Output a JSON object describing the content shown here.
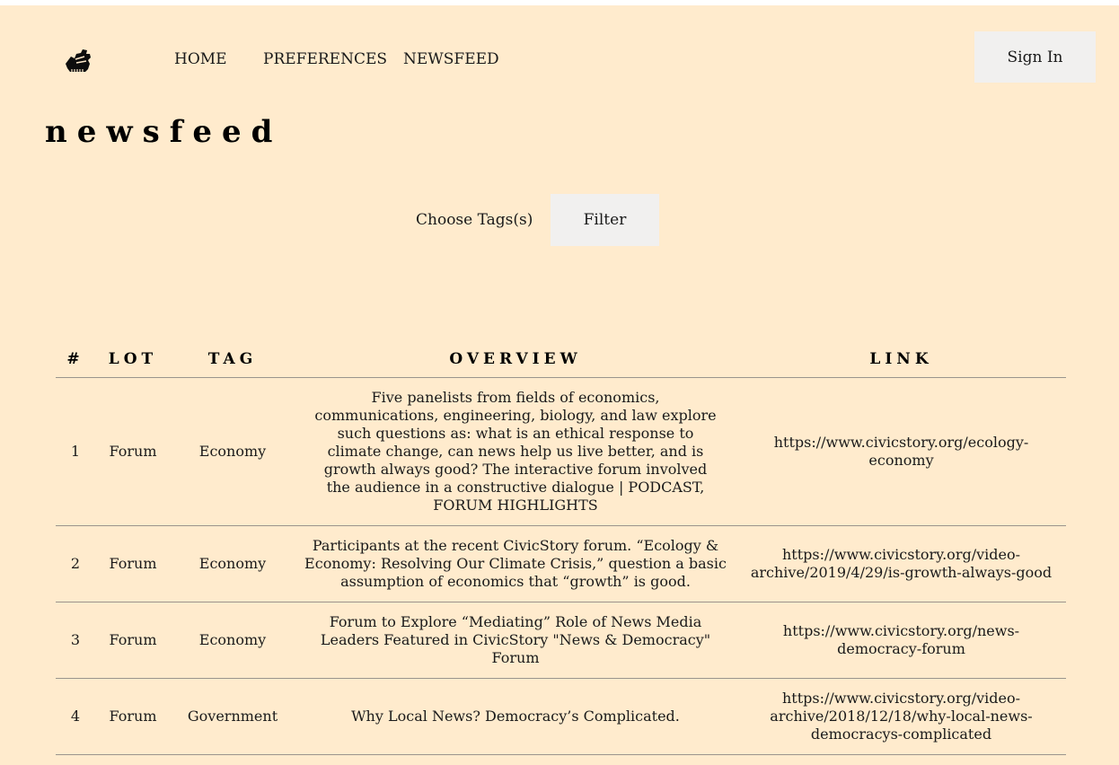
{
  "nav": {
    "logo_icon": "raised-fist-icon",
    "links": [
      "HOME",
      "PREFERENCES",
      "NEWSFEED"
    ],
    "sign_in": "Sign In"
  },
  "page": {
    "title": "newsfeed"
  },
  "filter": {
    "tags_label": "Choose Tags(s)",
    "button": "Filter"
  },
  "table": {
    "headers": [
      "#",
      "LOT",
      "TAG",
      "OVERVIEW",
      "LINK"
    ],
    "rows": [
      {
        "num": "1",
        "lot": "Forum",
        "tag": "Economy",
        "overview": "Five panelists from fields of economics, communications, engineering, biology, and law explore such questions as: what is an ethical response to climate change, can news help us live better, and is growth always good? The interactive forum involved the audience in a constructive dialogue | PODCAST, FORUM HIGHLIGHTS",
        "link": "https://www.civicstory.org/ecology-economy"
      },
      {
        "num": "2",
        "lot": "Forum",
        "tag": "Economy",
        "overview": "Participants at the recent CivicStory forum. “Ecology & Economy: Resolving Our Climate Crisis,” question a basic assumption of economics that “growth” is good.",
        "link": "https://www.civicstory.org/video-archive/2019/4/29/is-growth-always-good"
      },
      {
        "num": "3",
        "lot": "Forum",
        "tag": "Economy",
        "overview": "Forum to Explore “Mediating” Role of News Media Leaders Featured in CivicStory \"News & Democracy\" Forum",
        "link": "https://www.civicstory.org/news-democracy-forum"
      },
      {
        "num": "4",
        "lot": "Forum",
        "tag": "Government",
        "overview": "Why Local News? Democracy’s Complicated.",
        "link": "https://www.civicstory.org/video-archive/2018/12/18/why-local-news-democracys-complicated"
      }
    ]
  }
}
